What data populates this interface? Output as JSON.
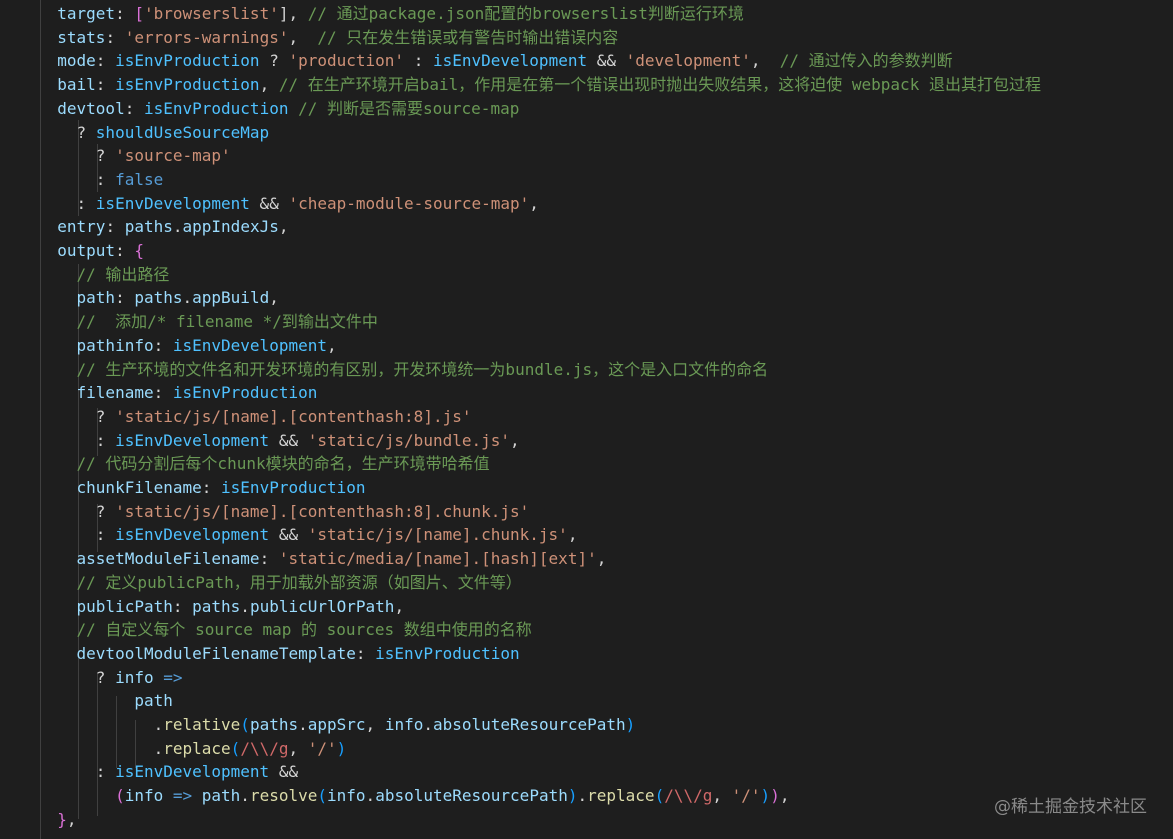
{
  "colors": {
    "background": "#1e1e1e",
    "property": "#9cdcfe",
    "string": "#ce9178",
    "comment": "#6a9955",
    "variable": "#4fc1ff",
    "keyword": "#569cd6",
    "function": "#dcdcaa",
    "regex": "#d16969",
    "bracket": "#ffd700",
    "text": "#d4d4d4"
  },
  "code_lines": [
    [
      [
        "  ",
        "op"
      ],
      [
        "target",
        "prop"
      ],
      [
        ": ",
        "punc"
      ],
      [
        "[",
        "bracket2"
      ],
      [
        "'browserslist'",
        "str"
      ],
      [
        "], ",
        "punc"
      ],
      [
        "// 通过package.json配置的browserslist判断运行环境",
        "cmt"
      ]
    ],
    [
      [
        "  ",
        "op"
      ],
      [
        "stats",
        "prop"
      ],
      [
        ": ",
        "punc"
      ],
      [
        "'errors-warnings'",
        "str"
      ],
      [
        ",  ",
        "punc"
      ],
      [
        "// 只在发生错误或有警告时输出错误内容",
        "cmt"
      ]
    ],
    [
      [
        "  ",
        "op"
      ],
      [
        "mode",
        "prop"
      ],
      [
        ": ",
        "punc"
      ],
      [
        "isEnvProduction",
        "var"
      ],
      [
        " ? ",
        "op"
      ],
      [
        "'production'",
        "str"
      ],
      [
        " : ",
        "op"
      ],
      [
        "isEnvDevelopment",
        "var"
      ],
      [
        " && ",
        "op"
      ],
      [
        "'development'",
        "str"
      ],
      [
        ",  ",
        "punc"
      ],
      [
        "// 通过传入的参数判断",
        "cmt"
      ]
    ],
    [
      [
        "  ",
        "op"
      ],
      [
        "bail",
        "prop"
      ],
      [
        ": ",
        "punc"
      ],
      [
        "isEnvProduction",
        "var"
      ],
      [
        ", ",
        "punc"
      ],
      [
        "// 在生产环境开启bail，作用是在第一个错误出现时抛出失败结果，这将迫使 webpack 退出其打包过程",
        "cmt"
      ]
    ],
    [
      [
        "  ",
        "op"
      ],
      [
        "devtool",
        "prop"
      ],
      [
        ": ",
        "punc"
      ],
      [
        "isEnvProduction",
        "var"
      ],
      [
        " ",
        "op"
      ],
      [
        "// 判断是否需要source-map",
        "cmt"
      ]
    ],
    [
      [
        "    ? ",
        "op"
      ],
      [
        "shouldUseSourceMap",
        "var"
      ]
    ],
    [
      [
        "      ? ",
        "op"
      ],
      [
        "'source-map'",
        "str"
      ]
    ],
    [
      [
        "      : ",
        "op"
      ],
      [
        "false",
        "kw"
      ]
    ],
    [
      [
        "    : ",
        "op"
      ],
      [
        "isEnvDevelopment",
        "var"
      ],
      [
        " && ",
        "op"
      ],
      [
        "'cheap-module-source-map'",
        "str"
      ],
      [
        ",",
        "punc"
      ]
    ],
    [
      [
        "  ",
        "op"
      ],
      [
        "entry",
        "prop"
      ],
      [
        ": ",
        "punc"
      ],
      [
        "paths",
        "prop"
      ],
      [
        ".",
        "punc"
      ],
      [
        "appIndexJs",
        "prop"
      ],
      [
        ",",
        "punc"
      ]
    ],
    [
      [
        "  ",
        "op"
      ],
      [
        "output",
        "prop"
      ],
      [
        ": ",
        "punc"
      ],
      [
        "{",
        "bracket2"
      ]
    ],
    [
      [
        "    ",
        "op"
      ],
      [
        "// 输出路径",
        "cmt"
      ]
    ],
    [
      [
        "    ",
        "op"
      ],
      [
        "path",
        "prop"
      ],
      [
        ": ",
        "punc"
      ],
      [
        "paths",
        "prop"
      ],
      [
        ".",
        "punc"
      ],
      [
        "appBuild",
        "prop"
      ],
      [
        ",",
        "punc"
      ]
    ],
    [
      [
        "    ",
        "op"
      ],
      [
        "//  添加/* filename */到输出文件中",
        "cmt"
      ]
    ],
    [
      [
        "    ",
        "op"
      ],
      [
        "pathinfo",
        "prop"
      ],
      [
        ": ",
        "punc"
      ],
      [
        "isEnvDevelopment",
        "var"
      ],
      [
        ",",
        "punc"
      ]
    ],
    [
      [
        "    ",
        "op"
      ],
      [
        "// 生产环境的文件名和开发环境的有区别，开发环境统一为bundle.js，这个是入口文件的命名",
        "cmt"
      ]
    ],
    [
      [
        "    ",
        "op"
      ],
      [
        "filename",
        "prop"
      ],
      [
        ": ",
        "punc"
      ],
      [
        "isEnvProduction",
        "var"
      ]
    ],
    [
      [
        "      ? ",
        "op"
      ],
      [
        "'static/js/[name].[contenthash:8].js'",
        "str"
      ]
    ],
    [
      [
        "      : ",
        "op"
      ],
      [
        "isEnvDevelopment",
        "var"
      ],
      [
        " && ",
        "op"
      ],
      [
        "'static/js/bundle.js'",
        "str"
      ],
      [
        ",",
        "punc"
      ]
    ],
    [
      [
        "    ",
        "op"
      ],
      [
        "// 代码分割后每个chunk模块的命名，生产环境带哈希值",
        "cmt"
      ]
    ],
    [
      [
        "    ",
        "op"
      ],
      [
        "chunkFilename",
        "prop"
      ],
      [
        ": ",
        "punc"
      ],
      [
        "isEnvProduction",
        "var"
      ]
    ],
    [
      [
        "      ? ",
        "op"
      ],
      [
        "'static/js/[name].[contenthash:8].chunk.js'",
        "str"
      ]
    ],
    [
      [
        "      : ",
        "op"
      ],
      [
        "isEnvDevelopment",
        "var"
      ],
      [
        " && ",
        "op"
      ],
      [
        "'static/js/[name].chunk.js'",
        "str"
      ],
      [
        ",",
        "punc"
      ]
    ],
    [
      [
        "    ",
        "op"
      ],
      [
        "assetModuleFilename",
        "prop"
      ],
      [
        ": ",
        "punc"
      ],
      [
        "'static/media/[name].[hash][ext]'",
        "str"
      ],
      [
        ",",
        "punc"
      ]
    ],
    [
      [
        "    ",
        "op"
      ],
      [
        "// 定义publicPath，用于加载外部资源（如图片、文件等）",
        "cmt"
      ]
    ],
    [
      [
        "    ",
        "op"
      ],
      [
        "publicPath",
        "prop"
      ],
      [
        ": ",
        "punc"
      ],
      [
        "paths",
        "prop"
      ],
      [
        ".",
        "punc"
      ],
      [
        "publicUrlOrPath",
        "prop"
      ],
      [
        ",",
        "punc"
      ]
    ],
    [
      [
        "    ",
        "op"
      ],
      [
        "// 自定义每个 source map 的 sources 数组中使用的名称",
        "cmt"
      ]
    ],
    [
      [
        "    ",
        "op"
      ],
      [
        "devtoolModuleFilenameTemplate",
        "prop"
      ],
      [
        ": ",
        "punc"
      ],
      [
        "isEnvProduction",
        "var"
      ]
    ],
    [
      [
        "      ? ",
        "op"
      ],
      [
        "info",
        "prop"
      ],
      [
        " => ",
        "kw"
      ]
    ],
    [
      [
        "          ",
        "op"
      ],
      [
        "path",
        "prop"
      ]
    ],
    [
      [
        "            .",
        "punc"
      ],
      [
        "relative",
        "fn"
      ],
      [
        "(",
        "bracket3"
      ],
      [
        "paths",
        "prop"
      ],
      [
        ".",
        "punc"
      ],
      [
        "appSrc",
        "prop"
      ],
      [
        ", ",
        "punc"
      ],
      [
        "info",
        "prop"
      ],
      [
        ".",
        "punc"
      ],
      [
        "absoluteResourcePath",
        "prop"
      ],
      [
        ")",
        "bracket3"
      ]
    ],
    [
      [
        "            .",
        "punc"
      ],
      [
        "replace",
        "fn"
      ],
      [
        "(",
        "bracket3"
      ],
      [
        "/\\\\/g",
        "re"
      ],
      [
        ", ",
        "punc"
      ],
      [
        "'/'",
        "str"
      ],
      [
        ")",
        "bracket3"
      ]
    ],
    [
      [
        "      : ",
        "op"
      ],
      [
        "isEnvDevelopment",
        "var"
      ],
      [
        " &&",
        "op"
      ]
    ],
    [
      [
        "        ",
        "op"
      ],
      [
        "(",
        "bracket2"
      ],
      [
        "info",
        "prop"
      ],
      [
        " => ",
        "kw"
      ],
      [
        "path",
        "prop"
      ],
      [
        ".",
        "punc"
      ],
      [
        "resolve",
        "fn"
      ],
      [
        "(",
        "bracket3"
      ],
      [
        "info",
        "prop"
      ],
      [
        ".",
        "punc"
      ],
      [
        "absoluteResourcePath",
        "prop"
      ],
      [
        ")",
        "bracket3"
      ],
      [
        ".",
        "punc"
      ],
      [
        "replace",
        "fn"
      ],
      [
        "(",
        "bracket3"
      ],
      [
        "/\\\\/g",
        "re"
      ],
      [
        ", ",
        "punc"
      ],
      [
        "'/'",
        "str"
      ],
      [
        ")",
        "bracket3"
      ],
      [
        ")",
        "bracket2"
      ],
      [
        ",",
        "punc"
      ]
    ],
    [
      [
        "  ",
        "op"
      ],
      [
        "}",
        "bracket2"
      ],
      [
        ",",
        "punc"
      ]
    ]
  ],
  "watermark": "@稀土掘金技术社区"
}
